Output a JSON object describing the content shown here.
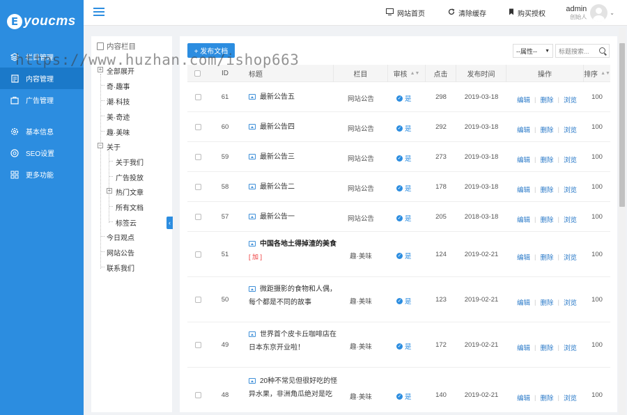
{
  "brand": {
    "badge": "E",
    "name": "youcms"
  },
  "sidebar": {
    "items": [
      {
        "label": "栏目管理",
        "icon": "layers-icon"
      },
      {
        "label": "内容管理",
        "icon": "content-icon",
        "active": true
      },
      {
        "label": "广告管理",
        "icon": "ad-icon"
      },
      {
        "label": "基本信息",
        "icon": "gear-icon"
      },
      {
        "label": "SEO设置",
        "icon": "seo-icon"
      },
      {
        "label": "更多功能",
        "icon": "grid-icon"
      }
    ]
  },
  "topbar": {
    "home": "网站首页",
    "clear_cache": "清除缓存",
    "buy": "购买授权",
    "user_name": "admin",
    "user_role": "创始人"
  },
  "tree": {
    "title": "内容栏目",
    "items": [
      {
        "label": "全部展开"
      },
      {
        "label": "奇·趣事"
      },
      {
        "label": "潮·科技"
      },
      {
        "label": "美·奇迹"
      },
      {
        "label": "趣·美味"
      },
      {
        "label": "关于"
      },
      {
        "label": "关于我们"
      },
      {
        "label": "广告投放"
      },
      {
        "label": "热门文章"
      },
      {
        "label": "所有文档"
      },
      {
        "label": "标签云"
      },
      {
        "label": "今日观点"
      },
      {
        "label": "网站公告"
      },
      {
        "label": "联系我们"
      }
    ]
  },
  "toolbar": {
    "publish": "+ 发布文档",
    "attr_select": "--属性--",
    "search_placeholder": "标题搜索..."
  },
  "table": {
    "headers": {
      "id": "ID",
      "title": "标题",
      "column": "栏目",
      "audit": "审核",
      "clicks": "点击",
      "date": "发布时间",
      "ops": "操作",
      "sort": "排序"
    },
    "ops": {
      "edit": "编辑",
      "delete": "删除",
      "view": "浏览"
    },
    "plus_tag": "[ 加 ]",
    "rows": [
      {
        "id": "61",
        "title": "最新公告五",
        "column": "网站公告",
        "audit": "是",
        "clicks": "298",
        "date": "2019-03-18",
        "sort": "100"
      },
      {
        "id": "60",
        "title": "最新公告四",
        "column": "网站公告",
        "audit": "是",
        "clicks": "292",
        "date": "2019-03-18",
        "sort": "100"
      },
      {
        "id": "59",
        "title": "最新公告三",
        "column": "网站公告",
        "audit": "是",
        "clicks": "273",
        "date": "2019-03-18",
        "sort": "100"
      },
      {
        "id": "58",
        "title": "最新公告二",
        "column": "网站公告",
        "audit": "是",
        "clicks": "178",
        "date": "2019-03-18",
        "sort": "100"
      },
      {
        "id": "57",
        "title": "最新公告一",
        "column": "网站公告",
        "audit": "是",
        "clicks": "205",
        "date": "2018-03-18",
        "sort": "100"
      },
      {
        "id": "51",
        "title": "中国各地土得掉渣的美食",
        "column": "趣·美味",
        "audit": "是",
        "clicks": "124",
        "date": "2019-02-21",
        "sort": "100",
        "bold": true
      },
      {
        "id": "50",
        "title": "微距摄影的食物和人偶，每个都是不同的故事",
        "column": "趣·美味",
        "audit": "是",
        "clicks": "123",
        "date": "2019-02-21",
        "sort": "100"
      },
      {
        "id": "49",
        "title": "世界首个皮卡丘咖啡店在日本东京开业啦！",
        "column": "趣·美味",
        "audit": "是",
        "clicks": "172",
        "date": "2019-02-21",
        "sort": "100"
      },
      {
        "id": "48",
        "title": "20种不常见但很好吃的怪异水果，非洲角瓜绝对是吃",
        "column": "趣·美味",
        "audit": "是",
        "clicks": "140",
        "date": "2019-02-21",
        "sort": "100"
      }
    ]
  },
  "watermark": "https://www.huzhan.com/ishop663"
}
